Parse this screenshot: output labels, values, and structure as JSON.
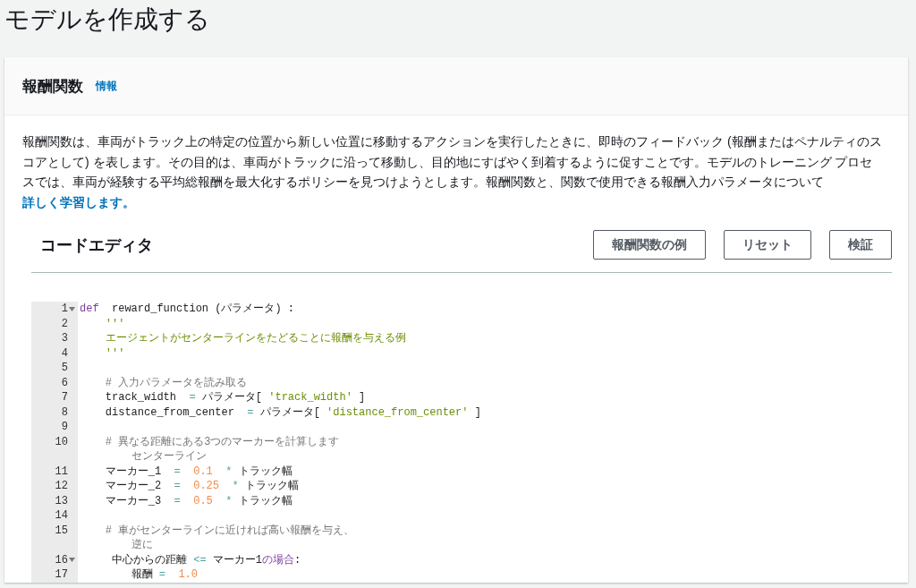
{
  "page_title": "モデルを作成する",
  "panel": {
    "title": "報酬関数",
    "info_link": "情報",
    "description": [
      {
        "kind": "text",
        "text": "報酬関数は、車両がトラック上の特定の位置から新しい位置に移動するアクションを実行したときに、即時のフィードバック (報酬またはペナルティのスコアとして) を表します。その目的は、車両がトラックに沿って移動し、目的地にすばやく到着するように促すことです。モデルのトレーニング プロセスでは、車両が経験する平均総報酬を最大化するポリシーを見つけようとします。報酬関数と、関数で使用できる報酬入力パラメータについて"
      },
      {
        "kind": "link",
        "text": "詳しく学習します。"
      }
    ],
    "editor": {
      "title": "コードエディタ",
      "buttons": [
        "報酬関数の例",
        "リセット",
        "検証"
      ],
      "lines": [
        {
          "number": "1",
          "foldable": true,
          "segments": [
            {
              "kind": "keyword",
              "text": "def"
            },
            {
              "kind": "plain",
              "text": "  reward_function (パラメータ) :"
            }
          ]
        },
        {
          "number": "2",
          "foldable": false,
          "segments": [
            {
              "kind": "string",
              "text": "    '''"
            }
          ]
        },
        {
          "number": "3",
          "foldable": false,
          "segments": [
            {
              "kind": "string",
              "text": "    エージェントがセンターラインをたどることに報酬を与える例"
            }
          ]
        },
        {
          "number": "4",
          "foldable": false,
          "segments": [
            {
              "kind": "string",
              "text": "    '''"
            }
          ]
        },
        {
          "number": "5",
          "foldable": false
        },
        {
          "number": "6",
          "foldable": false,
          "segments": [
            {
              "kind": "comment",
              "text": "    # 入力パラメータを読み取る"
            }
          ]
        },
        {
          "number": "7",
          "foldable": false,
          "segments": [
            {
              "kind": "plain",
              "text": "    track_width  "
            },
            {
              "kind": "operator",
              "text": "="
            },
            {
              "kind": "plain",
              "text": " パラメータ[ "
            },
            {
              "kind": "string",
              "text": "'track_width'"
            },
            {
              "kind": "plain",
              "text": " ]"
            }
          ]
        },
        {
          "number": "8",
          "foldable": false,
          "segments": [
            {
              "kind": "plain",
              "text": "    distance_from_center  "
            },
            {
              "kind": "operator",
              "text": "="
            },
            {
              "kind": "plain",
              "text": " パラメータ[ "
            },
            {
              "kind": "string",
              "text": "'distance_from_center'"
            },
            {
              "kind": "plain",
              "text": " ]"
            }
          ]
        },
        {
          "number": "9",
          "foldable": false
        },
        {
          "number": "10",
          "foldable": false,
          "segments": [
            {
              "kind": "comment",
              "text": "    # 異なる距離にある3つのマーカーを計算します"
            }
          ],
          "continuation": [
            {
              "kind": "comment",
              "text": "        センターライン"
            }
          ]
        },
        {
          "number": "11",
          "foldable": false,
          "segments": [
            {
              "kind": "plain",
              "text": "    マーカー_1  "
            },
            {
              "kind": "operator",
              "text": "="
            },
            {
              "kind": "number",
              "text": "  0.1"
            },
            {
              "kind": "operator",
              "text": "  *"
            },
            {
              "kind": "plain",
              "text": " トラック幅"
            }
          ]
        },
        {
          "number": "12",
          "foldable": false,
          "segments": [
            {
              "kind": "plain",
              "text": "    マーカー_2  "
            },
            {
              "kind": "operator",
              "text": "="
            },
            {
              "kind": "number",
              "text": "  0.25"
            },
            {
              "kind": "operator",
              "text": "  *"
            },
            {
              "kind": "plain",
              "text": " トラック幅"
            }
          ]
        },
        {
          "number": "13",
          "foldable": false,
          "segments": [
            {
              "kind": "plain",
              "text": "    マーカー_3  "
            },
            {
              "kind": "operator",
              "text": "="
            },
            {
              "kind": "number",
              "text": "  0.5"
            },
            {
              "kind": "operator",
              "text": "  *"
            },
            {
              "kind": "plain",
              "text": " トラック幅"
            }
          ]
        },
        {
          "number": "14",
          "foldable": false
        },
        {
          "number": "15",
          "foldable": false,
          "segments": [
            {
              "kind": "comment",
              "text": "    # 車がセンターラインに近ければ高い報酬を与え、"
            }
          ],
          "continuation": [
            {
              "kind": "comment",
              "text": "        逆に"
            }
          ]
        },
        {
          "number": "16",
          "foldable": true,
          "segments": [
            {
              "kind": "plain",
              "text": "     中心からの距離 "
            },
            {
              "kind": "operator",
              "text": "<="
            },
            {
              "kind": "plain",
              "text": " マーカー1"
            },
            {
              "kind": "keyword",
              "text": "の場合"
            },
            {
              "kind": "plain",
              "text": ":"
            }
          ]
        },
        {
          "number": "17",
          "foldable": false,
          "segments": [
            {
              "kind": "plain",
              "text": "        報酬 "
            },
            {
              "kind": "operator",
              "text": "="
            },
            {
              "kind": "number",
              "text": "  1.0"
            }
          ]
        }
      ]
    }
  }
}
